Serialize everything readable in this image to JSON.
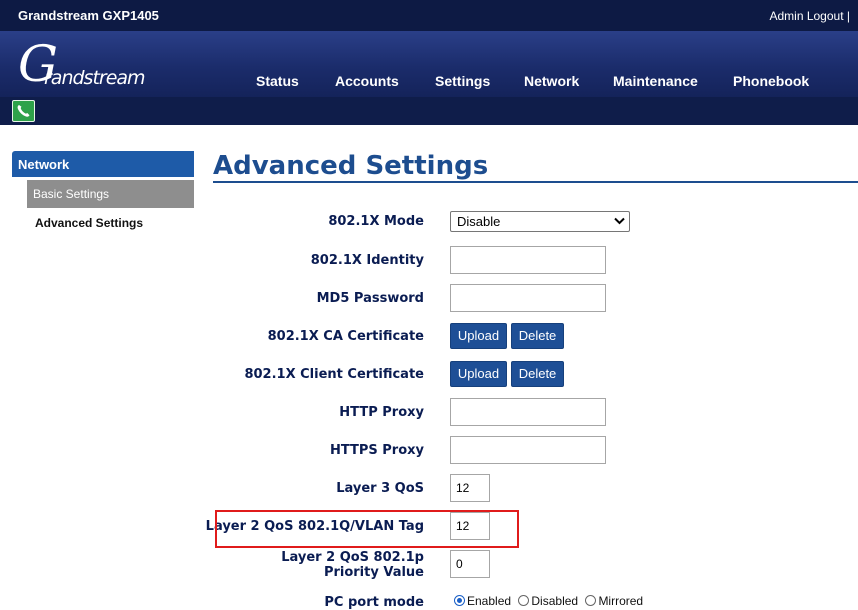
{
  "topbar": {
    "title": "Grandstream GXP1405",
    "admin": "Admin Logout |"
  },
  "logo": {
    "first": "G",
    "rest": "randstream"
  },
  "nav": [
    "Status",
    "Accounts",
    "Settings",
    "Network",
    "Maintenance",
    "Phonebook"
  ],
  "sidebar": {
    "section": "Network",
    "items": [
      "Basic Settings",
      "Advanced Settings"
    ]
  },
  "page": {
    "title": "Advanced Settings"
  },
  "form": {
    "mode_label": "802.1X Mode",
    "mode_value": "Disable",
    "identity_label": "802.1X Identity",
    "identity_value": "",
    "md5_label": "MD5 Password",
    "md5_value": "",
    "ca_label": "802.1X CA Certificate",
    "client_label": "802.1X Client Certificate",
    "upload": "Upload",
    "delete": "Delete",
    "http_label": "HTTP Proxy",
    "http_value": "",
    "https_label": "HTTPS Proxy",
    "https_value": "",
    "l3_label": "Layer 3 QoS",
    "l3_value": "12",
    "vlan_label": "Layer 2 QoS 802.1Q/VLAN Tag",
    "vlan_value": "12",
    "priority_label": "Layer 2 QoS 802.1p Priority Value",
    "priority_value": "0",
    "pc_label": "PC port mode",
    "pc_options": [
      "Enabled",
      "Disabled",
      "Mirrored"
    ],
    "pc_selected": "Enabled"
  },
  "colors": {
    "accent": "#1d4d8f",
    "highlight": "#e01b1b",
    "header": "#1b2c6b"
  }
}
